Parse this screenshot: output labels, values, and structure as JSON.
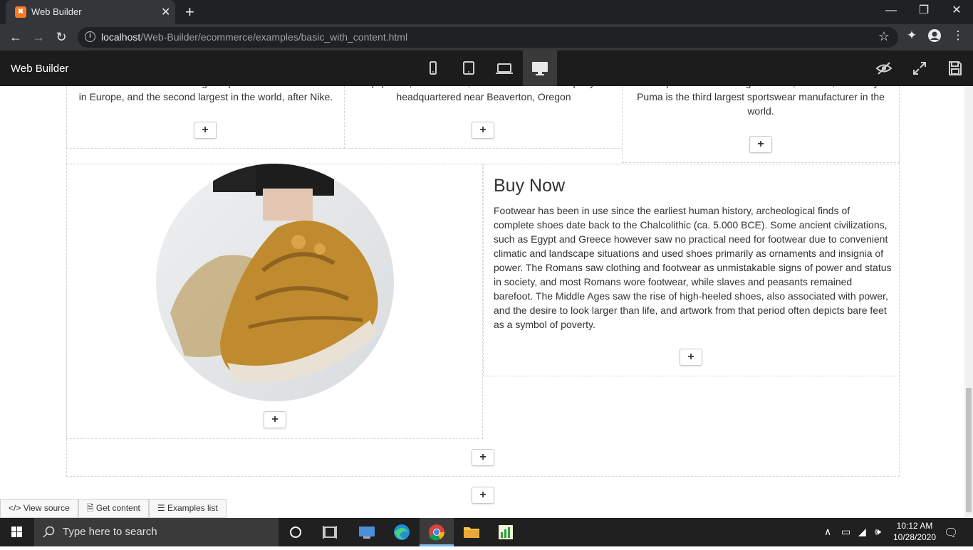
{
  "browser": {
    "tab_title": "Web Builder",
    "tab_favicon": "XAMPP",
    "url_host": "localhost",
    "url_path": "/Web-Builder/ecommerce/examples/basic_with_content.html"
  },
  "builder": {
    "brand": "Web Builder",
    "devices": [
      "mobile",
      "tablet",
      "laptop",
      "desktop"
    ],
    "active_device": "desktop"
  },
  "columns": {
    "col1_text": "and accessories. It is the largest sportswear manufacturer in Europe, and the second largest in the world, after Nike.",
    "col2_text": "equipment, accessories, and services. The company is headquartered near Beaverton, Oregon",
    "col3_text": "headquartered in Herzogenaurach, Bavaria, Germany. Puma is the third largest sportswear manufacturer in the world."
  },
  "feature": {
    "heading": "Buy Now",
    "paragraph": "Footwear has been in use since the earliest human history, archeological finds of complete shoes date back to the Chalcolithic (ca. 5.000 BCE). Some ancient civilizations, such as Egypt and Greece however saw no practical need for footwear due to convenient climatic and landscape situations and used shoes primarily as ornaments and insignia of power. The Romans saw clothing and footwear as unmistakable signs of power and status in society, and most Romans wore footwear, while slaves and peasants remained barefoot. The Middle Ages saw the rise of high-heeled shoes, also associated with power, and the desire to look larger than life, and artwork from that period often depicts bare feet as a symbol of poverty."
  },
  "add_button_label": "+",
  "bottom_tools": {
    "view_source": "View source",
    "get_content": "Get content",
    "examples_list": "Examples list"
  },
  "taskbar": {
    "search_placeholder": "Type here to search",
    "time": "10:12 AM",
    "date": "10/28/2020"
  }
}
